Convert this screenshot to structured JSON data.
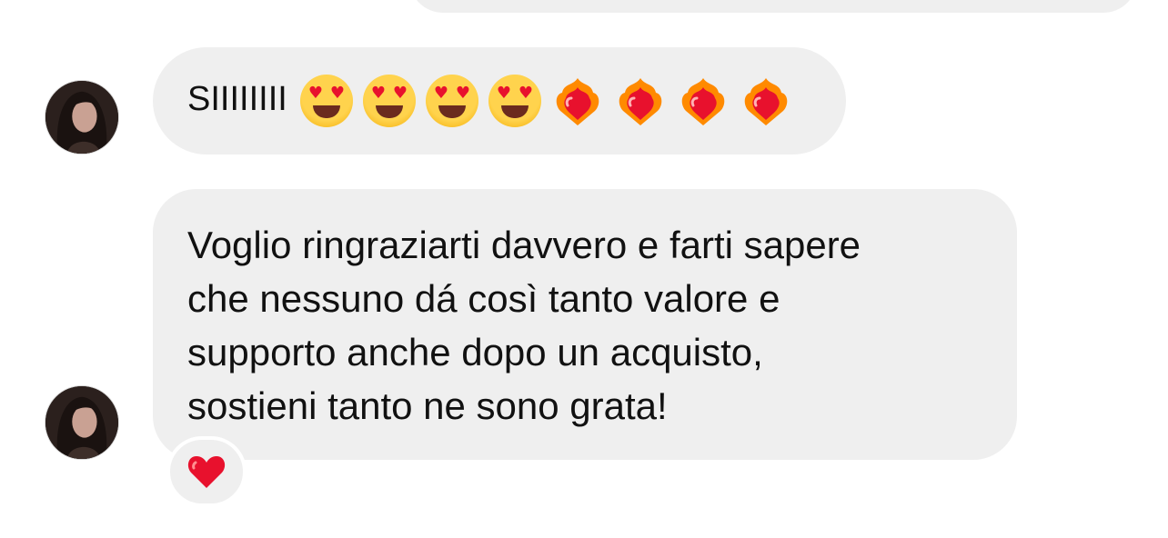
{
  "conversation": {
    "messages": [
      {
        "sender": "other",
        "text": "SIIIIIIII",
        "emojis": [
          "😍",
          "😍",
          "😍",
          "😍",
          "❤️‍🔥",
          "❤️‍🔥",
          "❤️‍🔥",
          "❤️‍🔥"
        ]
      },
      {
        "sender": "other",
        "text": "Voglio ringraziarti davvero e farti sapere\nche nessuno dá così tanto valore e\nsupporto anche dopo un acquisto,\nsostieni tanto ne sono grata!",
        "reaction": "❤️"
      }
    ]
  },
  "colors": {
    "bubble_background": "#efefef",
    "text": "#111111",
    "reaction_heart": "#e8112d"
  },
  "icons": {
    "avatar": "avatar-photo",
    "reaction": "red-heart-icon"
  }
}
